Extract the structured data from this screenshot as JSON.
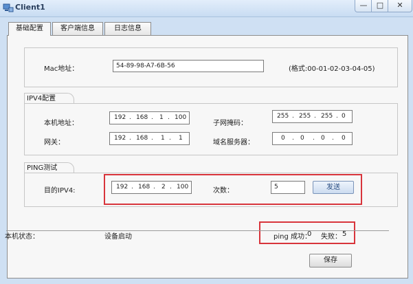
{
  "window": {
    "title": "Client1",
    "min_glyph": "—",
    "max_glyph": "□",
    "close_glyph": "✕"
  },
  "tabs": [
    {
      "label": "基础配置",
      "active": true
    },
    {
      "label": "客户端信息",
      "active": false
    },
    {
      "label": "日志信息",
      "active": false
    }
  ],
  "mac": {
    "label": "Mac地址：",
    "value": "54-89-98-A7-6B-56",
    "format_hint": "(格式:00-01-02-03-04-05)"
  },
  "ipv4": {
    "section_title": "IPV4配置",
    "local_label": "本机地址：",
    "local_ip": [
      "192",
      "168",
      "1",
      "100"
    ],
    "mask_label": "子网掩码：",
    "mask": [
      "255",
      "255",
      "255",
      "0"
    ],
    "gateway_label": "网关：",
    "gateway": [
      "192",
      "168",
      "1",
      "1"
    ],
    "dns_label": "域名服务器：",
    "dns": [
      "0",
      "0",
      "0",
      "0"
    ]
  },
  "ping": {
    "section_title": "PING测试",
    "dest_label": "目的IPV4:",
    "dest_ip": [
      "192",
      "168",
      "2",
      "100"
    ],
    "count_label": "次数：",
    "count": "5",
    "send_label": "发送"
  },
  "status": {
    "label": "本机状态：",
    "value": "设备启动",
    "success_label": "ping 成功：",
    "success_count": "0",
    "fail_label": "失败：",
    "fail_count": "5"
  },
  "save_label": "保存",
  "colors": {
    "highlight": "#d8343b",
    "title_bar": "#c8dcf2"
  },
  "icons": {
    "app": "network-client-icon"
  }
}
